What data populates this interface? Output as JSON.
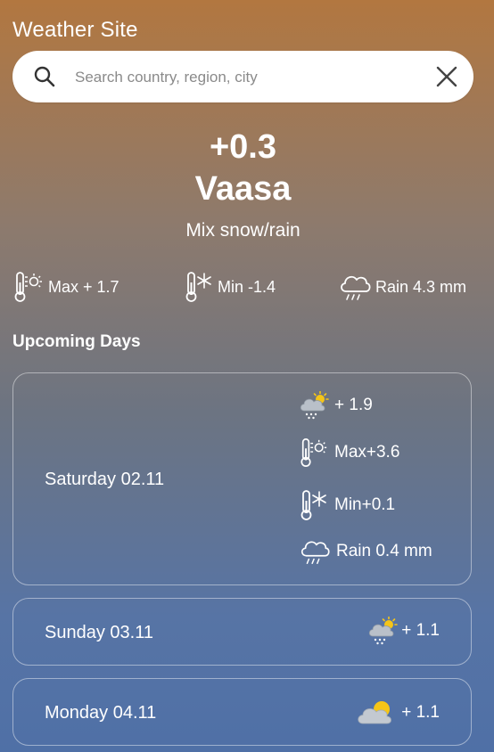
{
  "app": {
    "title": "Weather Site"
  },
  "search": {
    "placeholder": "Search country, region, city",
    "value": ""
  },
  "current": {
    "temperature": "+0.3",
    "city": "Vaasa",
    "description": "Mix snow/rain",
    "stats": {
      "max": "Max + 1.7",
      "min": "Min -1.4",
      "rain": "Rain 4.3 mm"
    }
  },
  "upcoming": {
    "title": "Upcoming Days",
    "days": [
      {
        "label": "Saturday 02.11",
        "icon": "snow-sun-cloud-icon",
        "temp": "+ 1.9",
        "max": "Max+3.6",
        "min": "Min+0.1",
        "rain": "Rain 0.4 mm"
      },
      {
        "label": "Sunday 03.11",
        "icon": "snow-sun-cloud-icon",
        "temp": "+ 1.1"
      },
      {
        "label": "Monday 04.11",
        "icon": "partly-cloudy-icon",
        "temp": "+ 1.1"
      }
    ]
  },
  "colors": {
    "gradient_top": "#b27740",
    "gradient_bottom": "#4f70a6",
    "text": "#ffffff",
    "sun": "#f5c518",
    "cloud": "#b9c0c9"
  }
}
